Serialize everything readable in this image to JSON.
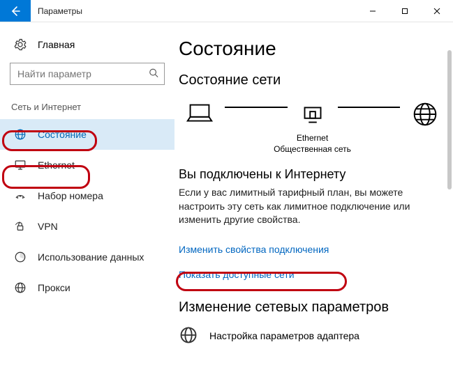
{
  "titlebar": {
    "title": "Параметры"
  },
  "sidebar": {
    "home": "Главная",
    "search_placeholder": "Найти параметр",
    "category": "Сеть и Интернет",
    "items": [
      {
        "label": "Состояние"
      },
      {
        "label": "Ethernet"
      },
      {
        "label": "Набор номера"
      },
      {
        "label": "VPN"
      },
      {
        "label": "Использование данных"
      },
      {
        "label": "Прокси"
      }
    ]
  },
  "content": {
    "page_title": "Состояние",
    "net_status_heading": "Состояние сети",
    "diagram": {
      "middle_label": "Ethernet",
      "middle_sub": "Общественная сеть"
    },
    "connected_heading": "Вы подключены к Интернету",
    "connected_desc": "Если у вас лимитный тарифный план, вы можете настроить эту сеть как лимитное подключение или изменить другие свойства.",
    "link_change_props": "Изменить свойства подключения",
    "link_show_nets": "Показать доступные сети",
    "change_params_heading": "Изменение сетевых параметров",
    "adapter_settings": "Настройка параметров адаптера"
  }
}
